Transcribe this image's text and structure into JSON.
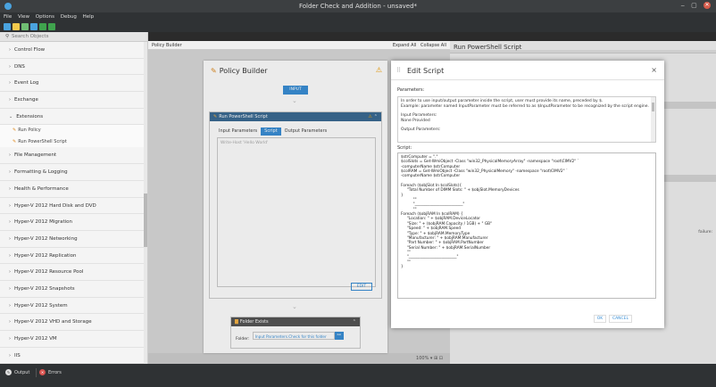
{
  "window": {
    "title": "Folder Check and Addition - unsaved*",
    "controls": [
      "‒",
      "▢",
      "✕"
    ]
  },
  "menu": [
    "File",
    "View",
    "Options",
    "Debug",
    "Help"
  ],
  "toolbar": {
    "buttons": [
      {
        "icon": "new-icon",
        "color": "#4aa3df"
      },
      {
        "icon": "open-icon",
        "color": "#f2c94c"
      },
      {
        "icon": "save-icon",
        "color": "#6fbf73"
      },
      {
        "icon": "save-as-icon",
        "color": "#4aa3df"
      },
      {
        "icon": "run-icon",
        "color": "#3fa34d"
      },
      {
        "icon": "stop-icon",
        "color": "#3fa34d"
      }
    ]
  },
  "sidebar": {
    "search_placeholder": "Search Objects",
    "items": [
      {
        "label": "Control Flow",
        "arrow": "›"
      },
      {
        "label": "DNS",
        "arrow": "›"
      },
      {
        "label": "Event Log",
        "arrow": "›"
      },
      {
        "label": "Exchange",
        "arrow": "›"
      },
      {
        "label": "Extensions",
        "arrow": "⌄"
      }
    ],
    "subitems": [
      "Run Policy",
      "Run PowerShell Script"
    ],
    "items_after": [
      {
        "label": "File Management",
        "arrow": "›"
      },
      {
        "label": "Formatting & Logging",
        "arrow": "›"
      },
      {
        "label": "Health & Performance",
        "arrow": "›"
      },
      {
        "label": "Hyper-V 2012 Hard Disk and DVD",
        "arrow": "›"
      },
      {
        "label": "Hyper-V 2012 Migration",
        "arrow": "›"
      },
      {
        "label": "Hyper-V 2012 Networking",
        "arrow": "›"
      },
      {
        "label": "Hyper-V 2012 Replication",
        "arrow": "›"
      },
      {
        "label": "Hyper-V 2012 Resource Pool",
        "arrow": "›"
      },
      {
        "label": "Hyper-V 2012 Snapshots",
        "arrow": "›"
      },
      {
        "label": "Hyper-V 2012 System",
        "arrow": "›"
      },
      {
        "label": "Hyper-V 2012 VHD and Storage",
        "arrow": "›"
      },
      {
        "label": "Hyper-V 2012 VM",
        "arrow": "›"
      },
      {
        "label": "IIS",
        "arrow": "›"
      }
    ]
  },
  "canvas_header": {
    "label": "Policy Builder",
    "expand_all": "Expand All",
    "collapse_all": "Collapse All"
  },
  "policy_builder": {
    "title": "Policy Builder",
    "input_button": "INPUT",
    "step": {
      "title": "Run PowerShell Script",
      "tabs": [
        "Input Parameters",
        "Script",
        "Output Parameters"
      ],
      "active_tab": "Script",
      "script_placeholder": "Write-Host 'Hello World'",
      "edit_button": "EDIT"
    },
    "folder_exists": {
      "title": "Folder Exists",
      "field_label": "Folder:",
      "field_value": "Input Parameters.Check for this folder"
    }
  },
  "canvas_footer": {
    "zoom": "100% ▾  ⊞ ⊡"
  },
  "right_panel": {
    "title": "Run PowerShell Script",
    "fragment": "failure:"
  },
  "edit_dialog": {
    "title": "Edit Script",
    "close": "×",
    "parameters_label": "Parameters:",
    "param_lines": [
      "In order to use input/output parameter inside the script, user must provide its name, preceded by $.",
      "Example: parameter named InputParameter must be referred to as $InputParameter to be recognized by the script engine."
    ],
    "input_params_label": "Input Parameters:",
    "input_params_value": "None Provided",
    "output_params_label": "Output Parameters:",
    "script_label": "Script:",
    "script_lines": [
      "$strComputer = \".\"",
      "$colSlots = Get-WmiObject -Class \"win32_PhysicalMemoryArray\" -namespace \"root\\CIMV2\" `",
      "-computerName $strComputer",
      "$colRAM = Get-WmiObject -Class \"win32_PhysicalMemory\" -namespace \"root\\CIMV2\" `",
      "-computerName $strComputer",
      "",
      "Foreach ($objSlot In $colSlots){",
      "     \"Total Number of DIMM Slots: \" + $objSlot.MemoryDevices",
      "}",
      "          \"\"",
      "          \"_________________________\"",
      "          \"\"",
      "Foreach ($objRAM In $colRAM) {",
      "     \"Location: \" + $objRAM.DeviceLocator",
      "     \"Size: \" + ($objRAM.Capacity / 1GB) + \" GB\"",
      "     \"Speed: \" + $objRAM.Speed",
      "     \"Type: \" + $objRAM.MemoryType",
      "     \"Manufacturer: \" + $objRAM.Manufacturer",
      "     \"Part Number: \" + $objRAM.PartNumber",
      "     \"Serial Number: \" + $objRAM.SerialNumber",
      "     \"\"",
      "     \"_________________________\"",
      "     \"\"",
      "}"
    ],
    "ok": "OK",
    "cancel": "CANCEL"
  },
  "statusbar": {
    "output": "Output",
    "errors": "Errors"
  }
}
